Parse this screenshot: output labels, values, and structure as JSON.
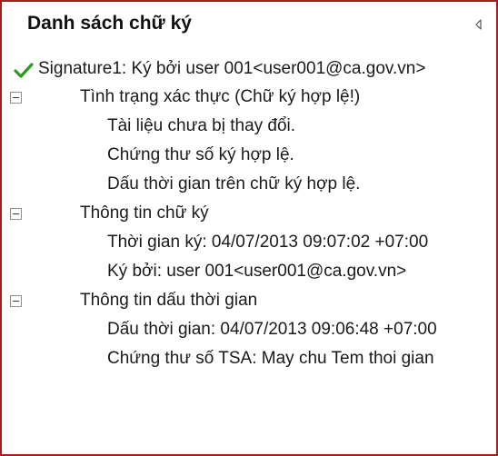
{
  "panel": {
    "title": "Danh sách chữ ký"
  },
  "tree": {
    "signature": {
      "icon": "check-icon",
      "status_color": "#2c9a1f",
      "label": "Signature1: Ký bởi user 001<user001@ca.gov.vn>"
    },
    "verification": {
      "label": "Tình trạng xác thực (Chữ ký hợp lệ!)",
      "items": [
        "Tài liệu chưa bị thay đổi.",
        "Chứng thư số ký hợp lệ.",
        "Dấu thời gian trên chữ ký hợp lệ."
      ]
    },
    "signature_info": {
      "label": "Thông tin chữ ký",
      "items": [
        "Thời gian ký: 04/07/2013 09:07:02 +07:00",
        "Ký bởi: user 001<user001@ca.gov.vn>"
      ]
    },
    "timestamp_info": {
      "label": "Thông tin dấu thời gian",
      "items": [
        "Dấu thời gian: 04/07/2013 09:06:48 +07:00",
        "Chứng thư số TSA: May chu Tem thoi gian"
      ]
    }
  }
}
